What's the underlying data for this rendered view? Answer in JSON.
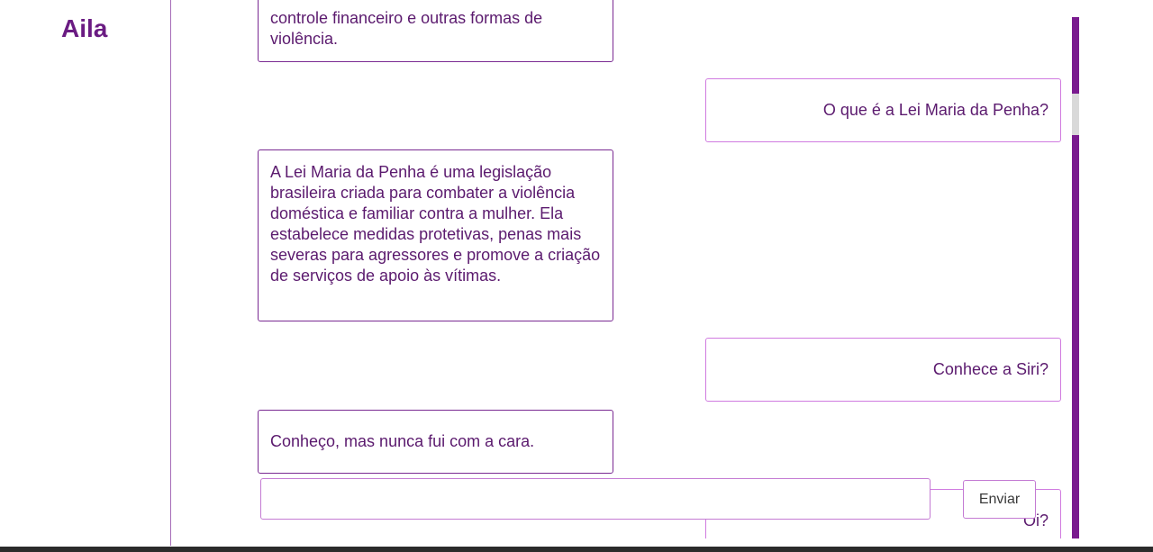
{
  "app": {
    "brand": "Aila"
  },
  "messages": [
    {
      "role": "bot",
      "text": "controle financeiro e outras formas de violência."
    },
    {
      "role": "user",
      "text": "O que é a Lei Maria da Penha?"
    },
    {
      "role": "bot",
      "text": "A Lei Maria da Penha é uma legislação brasileira criada para combater a violência doméstica e familiar contra a mulher. Ela estabelece medidas protetivas, penas mais severas para agressores e promove a criação de serviços de apoio às vítimas."
    },
    {
      "role": "user",
      "text": "Conhece a Siri?"
    },
    {
      "role": "bot",
      "text": "Conheço, mas nunca fui com a cara."
    },
    {
      "role": "user",
      "text": "Oi?"
    }
  ],
  "composer": {
    "value": "",
    "placeholder": "",
    "send_label": "Enviar"
  },
  "colors": {
    "brand": "#6a1b82",
    "accent": "#7a1b8f",
    "user_border": "#d07be0"
  }
}
